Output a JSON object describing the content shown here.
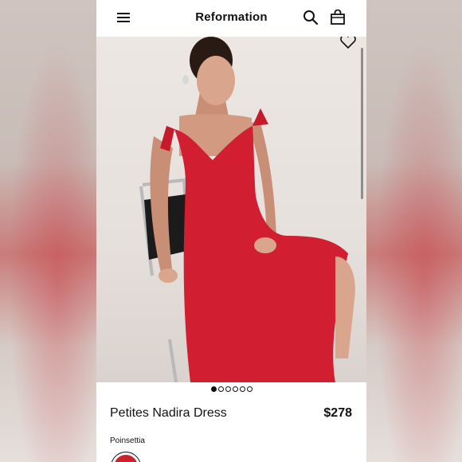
{
  "header": {
    "brand": "Reformation",
    "icons": [
      "menu-icon",
      "search-icon",
      "bag-icon"
    ]
  },
  "product": {
    "name": "Petites Nadira Dress",
    "price": "$278",
    "color_name": "Poinsettia",
    "swatch_color": "#d0202f"
  },
  "gallery": {
    "image_count": 6,
    "active_index": 0
  },
  "colors": {
    "dress": "#d21e31",
    "accent": "#111111"
  }
}
